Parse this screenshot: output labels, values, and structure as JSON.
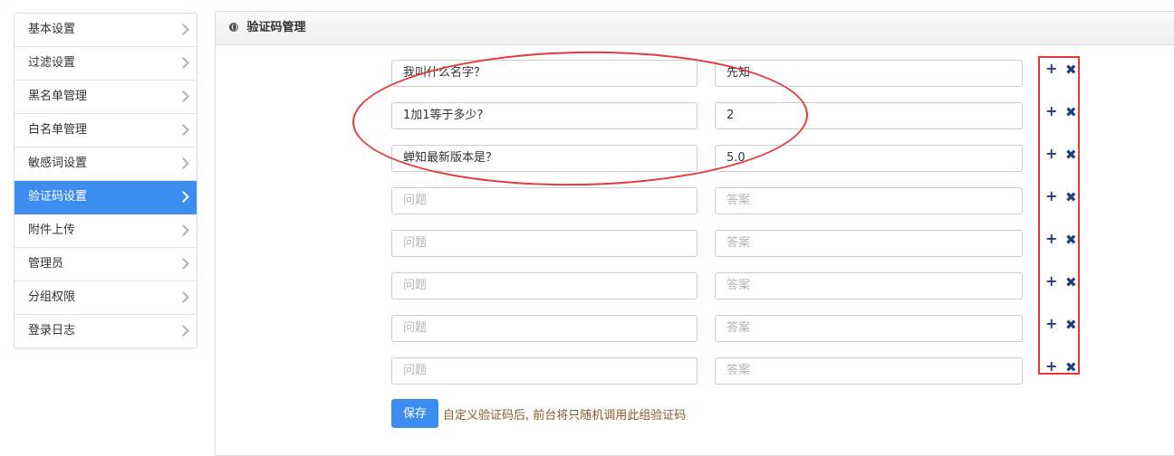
{
  "sidebar": {
    "items": [
      {
        "label": "基本设置"
      },
      {
        "label": "过滤设置"
      },
      {
        "label": "黑名单管理"
      },
      {
        "label": "白名单管理"
      },
      {
        "label": "敏感词设置"
      },
      {
        "label": "验证码设置",
        "active": true
      },
      {
        "label": "附件上传"
      },
      {
        "label": "管理员"
      },
      {
        "label": "分组权限"
      },
      {
        "label": "登录日志"
      }
    ]
  },
  "panel": {
    "title": "验证码管理",
    "rows": [
      {
        "question": "我叫什么名字？",
        "answer": "先知"
      },
      {
        "question": "1加1等于多少?",
        "answer": "2"
      },
      {
        "question": "蝉知最新版本是？",
        "answer": "5.0"
      },
      {
        "question": "",
        "answer": ""
      },
      {
        "question": "",
        "answer": ""
      },
      {
        "question": "",
        "answer": ""
      },
      {
        "question": "",
        "answer": ""
      },
      {
        "question": "",
        "answer": ""
      }
    ],
    "placeholders": {
      "question": "问题",
      "answer": "答案"
    },
    "add_symbol": "+",
    "delete_symbol": "✖",
    "save_label": "保存",
    "hint": "自定义验证码后, 前台将只随机调用此组验证码"
  },
  "colors": {
    "accent": "#3d8cf0",
    "annotation": "#e53935",
    "control_icon": "#1f3f7a",
    "hint_text": "#8a5a2b"
  }
}
